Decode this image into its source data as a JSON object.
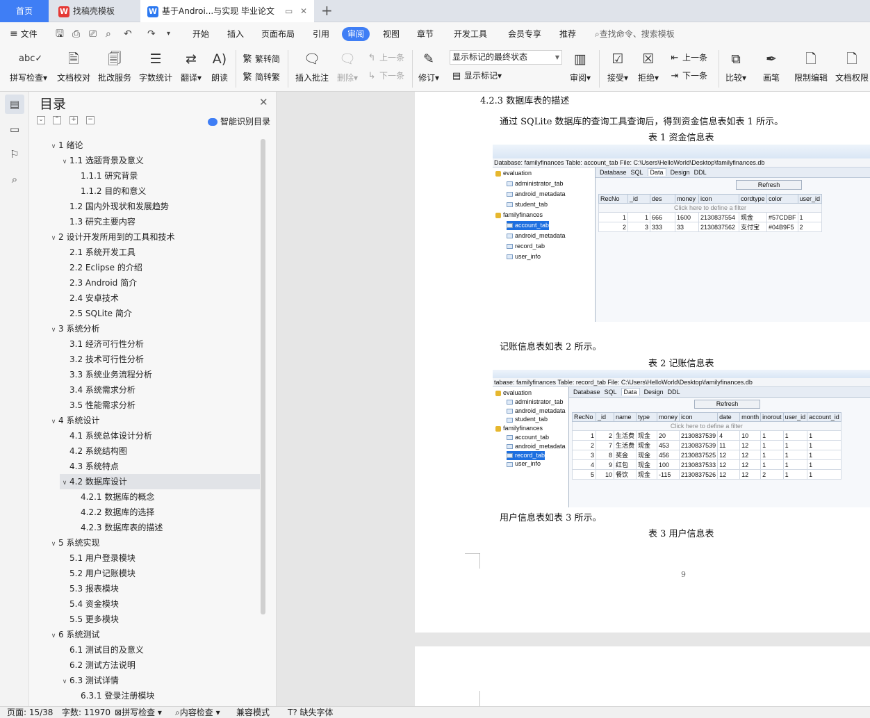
{
  "tabs": {
    "home": "首页",
    "templates": "找稿壳模板",
    "doc": "基于Androi...与实现 毕业论文"
  },
  "menu": {
    "file": "文件",
    "items": [
      "开始",
      "插入",
      "页面布局",
      "引用",
      "审阅",
      "视图",
      "章节",
      "开发工具",
      "会员专享",
      "推荐"
    ],
    "active": "审阅",
    "search": "查找命令、搜索模板"
  },
  "ribbon": {
    "spell": "拼写检查",
    "proof": "文档校对",
    "correct": "批改服务",
    "wordcount": "字数统计",
    "translate": "翻译",
    "read": "朗读",
    "to_trad": "繁转简",
    "to_simp": "简转繁",
    "insert_comment": "插入批注",
    "delete": "删除",
    "prev_c": "上一条",
    "next_c": "下一条",
    "revise": "修订",
    "markup_select": "显示标记的最终状态",
    "show_markup": "显示标记",
    "review": "审阅",
    "accept": "接受",
    "reject": "拒绝",
    "prev": "上一条",
    "next": "下一条",
    "compare": "比较",
    "ink": "画笔",
    "restrict": "限制编辑",
    "permission": "文档权限"
  },
  "toc": {
    "title": "目录",
    "smart": "智能识别目录",
    "items": [
      {
        "t": "1 绪论",
        "lv": 1,
        "tw": "v"
      },
      {
        "t": "1.1 选题背景及意义",
        "lv": 2,
        "tw": "v"
      },
      {
        "t": "1.1.1  研究背景",
        "lv": 3,
        "tw": ""
      },
      {
        "t": "1.1.2  目的和意义",
        "lv": 3,
        "tw": ""
      },
      {
        "t": "1.2 国内外现状和发展趋势",
        "lv": 2,
        "tw": ""
      },
      {
        "t": "1.3  研究主要内容",
        "lv": 2,
        "tw": ""
      },
      {
        "t": "2 设计开发所用到的工具和技术",
        "lv": 1,
        "tw": "v"
      },
      {
        "t": "2.1 系统开发工具",
        "lv": 2,
        "tw": ""
      },
      {
        "t": "2.2 Eclipse 的介绍",
        "lv": 2,
        "tw": ""
      },
      {
        "t": "2.3 Android 简介",
        "lv": 2,
        "tw": ""
      },
      {
        "t": "2.4 安卓技术",
        "lv": 2,
        "tw": ""
      },
      {
        "t": "2.5 SQLite 简介",
        "lv": 2,
        "tw": ""
      },
      {
        "t": "3 系统分析",
        "lv": 1,
        "tw": "v"
      },
      {
        "t": "3.1  经济可行性分析",
        "lv": 2,
        "tw": ""
      },
      {
        "t": "3.2  技术可行性分析",
        "lv": 2,
        "tw": ""
      },
      {
        "t": "3.3  系统业务流程分析",
        "lv": 2,
        "tw": ""
      },
      {
        "t": "3.4  系统需求分析",
        "lv": 2,
        "tw": ""
      },
      {
        "t": "3.5  性能需求分析",
        "lv": 2,
        "tw": ""
      },
      {
        "t": "4 系统设计",
        "lv": 1,
        "tw": "v"
      },
      {
        "t": "4.1 系统总体设计分析",
        "lv": 2,
        "tw": ""
      },
      {
        "t": "4.2 系统结构图",
        "lv": 2,
        "tw": ""
      },
      {
        "t": "4.3 系统特点",
        "lv": 2,
        "tw": ""
      },
      {
        "t": "4.2 数据库设计",
        "lv": 2,
        "tw": "v",
        "sel": true
      },
      {
        "t": "4.2.1 数据库的概念",
        "lv": 3,
        "tw": ""
      },
      {
        "t": "4.2.2 数据库的选择",
        "lv": 3,
        "tw": ""
      },
      {
        "t": "4.2.3 数据库表的描述",
        "lv": 3,
        "tw": ""
      },
      {
        "t": "5 系统实现",
        "lv": 1,
        "tw": "v"
      },
      {
        "t": "5.1 用户登录模块",
        "lv": 2,
        "tw": ""
      },
      {
        "t": "5.2 用户记账模块",
        "lv": 2,
        "tw": ""
      },
      {
        "t": "5.3 报表模块",
        "lv": 2,
        "tw": ""
      },
      {
        "t": "5.4 资金模块",
        "lv": 2,
        "tw": ""
      },
      {
        "t": "5.5 更多模块",
        "lv": 2,
        "tw": ""
      },
      {
        "t": "6 系统测试",
        "lv": 1,
        "tw": "v"
      },
      {
        "t": "6.1 测试目的及意义",
        "lv": 2,
        "tw": ""
      },
      {
        "t": "6.2 测试方法说明",
        "lv": 2,
        "tw": ""
      },
      {
        "t": "6.3 测试详情",
        "lv": 2,
        "tw": "v"
      },
      {
        "t": "6.3.1  登录注册模块",
        "lv": 3,
        "tw": ""
      }
    ]
  },
  "doc": {
    "heading": "4.2.3 数据库表的描述",
    "para1": "通过 SQLite 数据库的查询工具查询后，得到资金信息表如表 1 所示。",
    "cap1": "表 1  资金信息表",
    "para2": "记账信息表如表 2 所示。",
    "cap2": "表 2  记账信息表",
    "para3": "用户信息表如表 3 所示。",
    "cap3": "表 3  用户信息表",
    "page": "9"
  },
  "shot1": {
    "path": "Database: familyfinances  Table: account_tab  File: C:\\Users\\HelloWorld\\Desktop\\familyfinances.db",
    "tree": [
      {
        "t": "evaluation",
        "db": true
      },
      {
        "t": "administrator_tab"
      },
      {
        "t": "android_metadata"
      },
      {
        "t": "student_tab"
      },
      {
        "t": "familyfinances",
        "db": true
      },
      {
        "t": "account_tab",
        "hl": true
      },
      {
        "t": "android_metadata"
      },
      {
        "t": "record_tab"
      },
      {
        "t": "user_info"
      }
    ],
    "tabs": [
      "Database",
      "SQL",
      "Data",
      "Design",
      "DDL"
    ],
    "refresh": "Refresh",
    "cols": [
      "RecNo",
      "_id",
      "des",
      "money",
      "icon",
      "cordtype",
      "color",
      "user_id"
    ],
    "filter": "Click here to define a filter",
    "rows": [
      [
        "1",
        "1",
        "666",
        "1600",
        "2130837554",
        "现金",
        "#57CDBF",
        "1"
      ],
      [
        "2",
        "3",
        "333",
        "33",
        "2130837562",
        "支付宝",
        "#04B9F5",
        "2"
      ]
    ]
  },
  "shot2": {
    "path": "tabase: familyfinances  Table: record_tab  File: C:\\Users\\HelloWorld\\Desktop\\familyfinances.db",
    "tree": [
      {
        "t": "evaluation",
        "db": true
      },
      {
        "t": "administrator_tab"
      },
      {
        "t": "android_metadata"
      },
      {
        "t": "student_tab"
      },
      {
        "t": "familyfinances",
        "db": true
      },
      {
        "t": "account_tab"
      },
      {
        "t": "android_metadata"
      },
      {
        "t": "record_tab",
        "hl": true
      },
      {
        "t": "user_info"
      }
    ],
    "tabs": [
      "Database",
      "SQL",
      "Data",
      "Design",
      "DDL"
    ],
    "refresh": "Refresh",
    "cols": [
      "RecNo",
      "_id",
      "name",
      "type",
      "money",
      "icon",
      "date",
      "month",
      "inorout",
      "user_id",
      "account_id"
    ],
    "filter": "Click here to define a filter",
    "rows": [
      [
        "1",
        "2",
        "生活费",
        "现金",
        "20",
        "2130837539",
        "4",
        "10",
        "1",
        "1",
        "1"
      ],
      [
        "2",
        "7",
        "生活费",
        "现金",
        "453",
        "2130837539",
        "11",
        "12",
        "1",
        "1",
        "1"
      ],
      [
        "3",
        "8",
        "奖金",
        "现金",
        "456",
        "2130837525",
        "12",
        "12",
        "1",
        "1",
        "1"
      ],
      [
        "4",
        "9",
        "红包",
        "现金",
        "100",
        "2130837533",
        "12",
        "12",
        "1",
        "1",
        "1"
      ],
      [
        "5",
        "10",
        "餐饮",
        "现金",
        "-115",
        "2130837526",
        "12",
        "12",
        "2",
        "1",
        "1"
      ]
    ]
  },
  "status": {
    "page": "页面: 15/38",
    "words": "字数: 11970",
    "spell": "拼写检查",
    "content": "内容检查",
    "compat": "兼容模式",
    "font": "缺失字体"
  },
  "colors": {
    "accent": "#3f7ef5",
    "selection": "#1d6fe0"
  }
}
